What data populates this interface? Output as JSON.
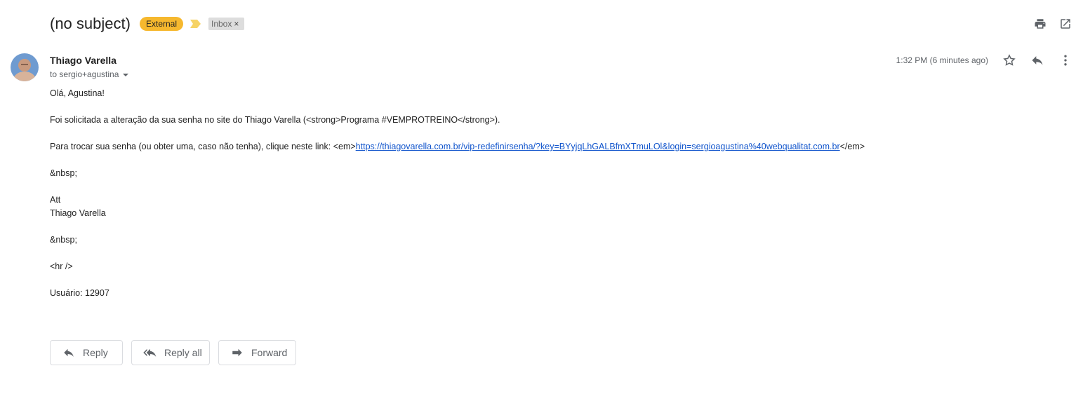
{
  "header": {
    "subject": "(no subject)",
    "external_badge": "External",
    "label": "Inbox",
    "label_remove": "×",
    "icons": [
      "print-icon",
      "open-in-new-window-icon",
      "importance-marker-icon"
    ]
  },
  "message": {
    "sender_name": "Thiago Varella",
    "recipient": "to sergio+agustina",
    "timestamp": "1:32 PM (6 minutes ago)",
    "action_icons": [
      "star-icon",
      "reply-icon",
      "more-options-icon"
    ]
  },
  "body": {
    "greeting": "Olá, Agustina!",
    "line1": "Foi solicitada a alteração da sua senha no site do Thiago Varella (<strong>Programa #VEMPROTREINO</strong>).",
    "line2_prefix": "Para trocar sua senha (ou obter uma, caso não tenha), clique neste link: <em>",
    "line2_link": "https://thiagovarella.com.br/vip-redefinirsenha/?key=BYyjqLhGALBfmXTmuLOl&login=sergioagustina%40webqualitat.com.br",
    "line2_suffix": "</em>",
    "nbsp1": "&nbsp;",
    "sign_att": "Att",
    "sign_name": "Thiago Varella",
    "nbsp2": "&nbsp;",
    "hr": "<hr />",
    "user": "Usuário: 12907"
  },
  "footer": {
    "reply": "Reply",
    "reply_all": "Reply all",
    "forward": "Forward"
  },
  "colors": {
    "external_badge": "#f6b82e",
    "importance": "#f6d365",
    "link": "#1155cc",
    "label_bg": "#dddddd"
  }
}
